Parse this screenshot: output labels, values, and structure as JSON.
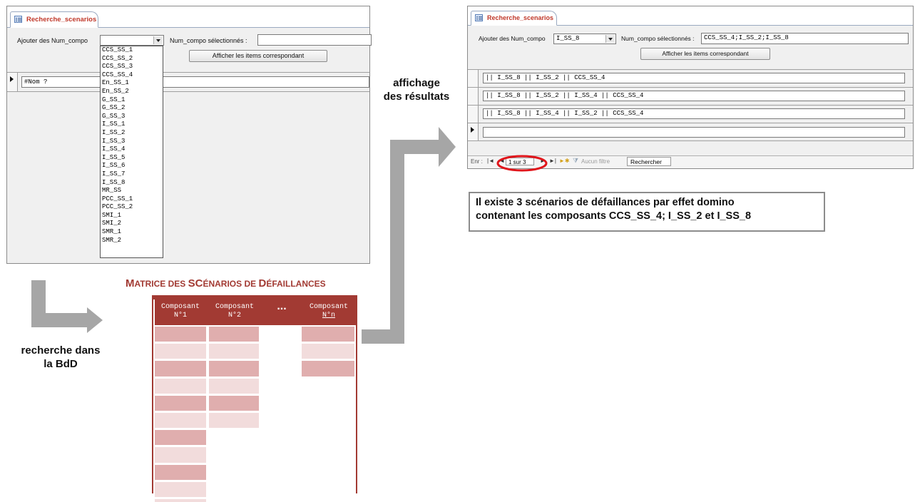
{
  "left_form": {
    "tab_title": "Recherche_scenarios",
    "add_label": "Ajouter des Num_compo",
    "add_value": "",
    "selected_label": "Num_compo sélectionnés :",
    "selected_value": "",
    "show_button": "Afficher les items correspondant",
    "record_value": "#Nom ?",
    "dropdown_options": [
      "CCS_SS_1",
      "CCS_SS_2",
      "CCS_SS_3",
      "CCS_SS_4",
      "En_SS_1",
      "En_SS_2",
      "G_SS_1",
      "G_SS_2",
      "G_SS_3",
      "I_SS_1",
      "I_SS_2",
      "I_SS_3",
      "I_SS_4",
      "I_SS_5",
      "I_SS_6",
      "I_SS_7",
      "I_SS_8",
      "MR_SS",
      "PCC_SS_1",
      "PCC_SS_2",
      "SMI_1",
      "SMI_2",
      "SMR_1",
      "SMR_2"
    ]
  },
  "right_form": {
    "tab_title": "Recherche_scenarios",
    "add_label": "Ajouter des Num_compo",
    "add_value": "I_SS_8",
    "selected_label": "Num_compo sélectionnés :",
    "selected_value": "CCS_SS_4;I_SS_2;I_SS_8",
    "show_button": "Afficher les items correspondant",
    "records": [
      "|| I_SS_8 || I_SS_2 || CCS_SS_4",
      "|| I_SS_8 || I_SS_2 || I_SS_4 || CCS_SS_4",
      "|| I_SS_8 || I_SS_4 || I_SS_2 || CCS_SS_4",
      ""
    ],
    "nav": {
      "record_label": "Enr :",
      "position": "1 sur 3",
      "filter": "Aucun filtre",
      "search": "Rechercher"
    }
  },
  "annotations": {
    "display_results": [
      "affichage",
      "des résultats"
    ],
    "search_db": [
      "recherche dans",
      "la BdD"
    ],
    "result_message": [
      "Il existe 3 scénarios de défaillances par effet domino",
      "contenant les composants CCS_SS_4; I_SS_2 et I_SS_8"
    ]
  },
  "matrix": {
    "title_big1": "M",
    "title_small1": "ATRICE DES ",
    "title_big2": "SC",
    "title_small2": "ÉNARIOS DE ",
    "title_big3": "D",
    "title_small3": "ÉFAILLANCES",
    "headers": [
      [
        "Composant",
        "N°1"
      ],
      [
        "Composant",
        "N°2"
      ],
      [
        "...",
        ""
      ],
      [
        "Composant",
        "N°n"
      ]
    ]
  },
  "colors": {
    "matrix_red": "#a23a33",
    "cell_dark": "#e0aeae",
    "cell_light": "#f2dcdc",
    "arrow_gray": "#a6a6a6",
    "highlight_red": "#e0151b"
  }
}
